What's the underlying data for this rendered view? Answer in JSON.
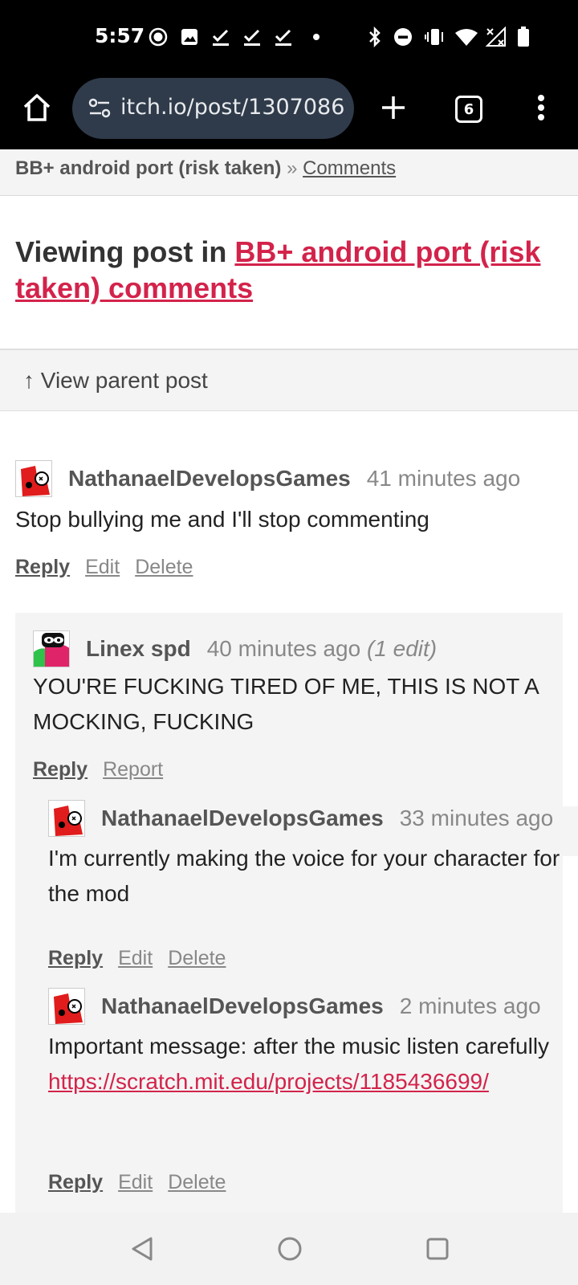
{
  "status_bar": {
    "time": "5:57",
    "icons_left": [
      "record-icon",
      "image-icon",
      "check-icon",
      "check-icon",
      "check-icon",
      "dot-icon"
    ],
    "icons_right": [
      "bluetooth-icon",
      "do-not-disturb-icon",
      "vibrate-icon",
      "wifi-icon",
      "no-signal-icon",
      "battery-icon"
    ]
  },
  "browser": {
    "url": "itch.io/post/1307086",
    "tab_count": "6"
  },
  "breadcrumb": {
    "game": "BB+ android port (risk taken)",
    "separator": "»",
    "comments_link": "Comments"
  },
  "heading": {
    "prefix": "Viewing post in ",
    "link": "BB+ android port (risk taken) comments"
  },
  "parent_link": "↑ View parent post",
  "comments": [
    {
      "author": "NathanaelDevelopsGames",
      "time": "41 minutes ago",
      "text": "Stop bullying me and I'll stop commenting",
      "actions": [
        "Reply",
        "Edit",
        "Delete"
      ]
    },
    {
      "author": "Linex spd",
      "time": "40 minutes ago",
      "edit_note": "(1 edit)",
      "text": "YOU'RE FUCKING TIRED OF ME, THIS IS NOT A MOCKING, FUCKING",
      "actions": [
        "Reply",
        "Report"
      ]
    },
    {
      "author": "NathanaelDevelopsGames",
      "time": "33 minutes ago",
      "text": "I'm currently making the voice for your character for the mod",
      "actions": [
        "Reply",
        "Edit",
        "Delete"
      ]
    },
    {
      "author": "NathanaelDevelopsGames",
      "time": "2 minutes ago",
      "text": "Important message: after the music listen carefully",
      "link": "https://scratch.mit.edu/projects/1185436699/",
      "actions": [
        "Reply",
        "Edit",
        "Delete"
      ]
    }
  ],
  "colors": {
    "accent": "#d3234b",
    "status_bg": "#000000",
    "url_pill": "#2f3b4a",
    "nested_bg": "#f4f4f4"
  }
}
